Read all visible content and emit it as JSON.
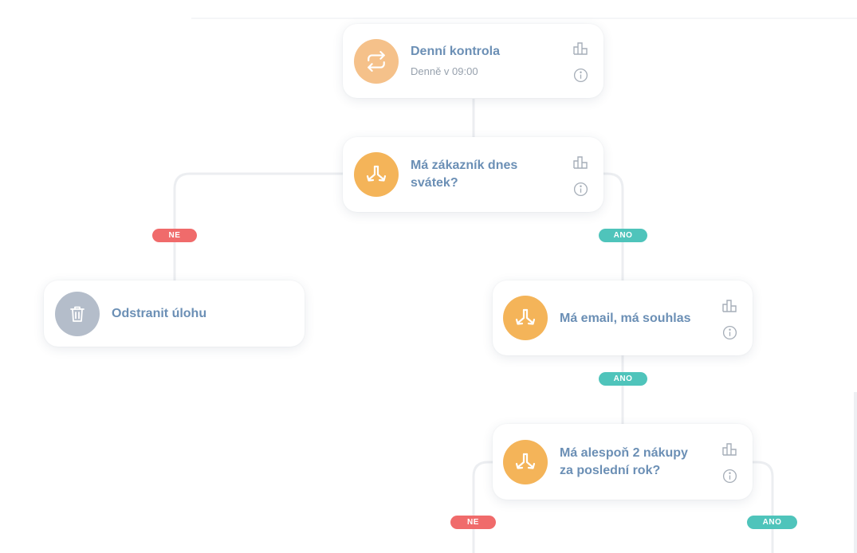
{
  "colors": {
    "trigger": "#f5c18a",
    "condition": "#f4b459",
    "action_delete": "#b4bdca",
    "title": "#6b8fb5",
    "no": "#f06b6b",
    "yes": "#4fc4bb",
    "connector": "#eceef1"
  },
  "nodes": {
    "daily_check": {
      "title": "Denní kontrola",
      "subtitle": "Denně v 09:00",
      "icon": "repeat-icon"
    },
    "name_day": {
      "title_line1": "Má zákazník dnes",
      "title_line2": "svátek?",
      "icon": "split-icon"
    },
    "delete_task": {
      "title": "Odstranit úlohu",
      "icon": "trash-icon"
    },
    "email_consent": {
      "title": "Má email, má souhlas",
      "icon": "split-icon"
    },
    "purchases": {
      "title_line1": "Má alespoň 2 nákupy",
      "title_line2": "za poslední rok?",
      "icon": "split-icon"
    }
  },
  "branches": {
    "no_label": "NE",
    "yes_label": "ANO"
  }
}
